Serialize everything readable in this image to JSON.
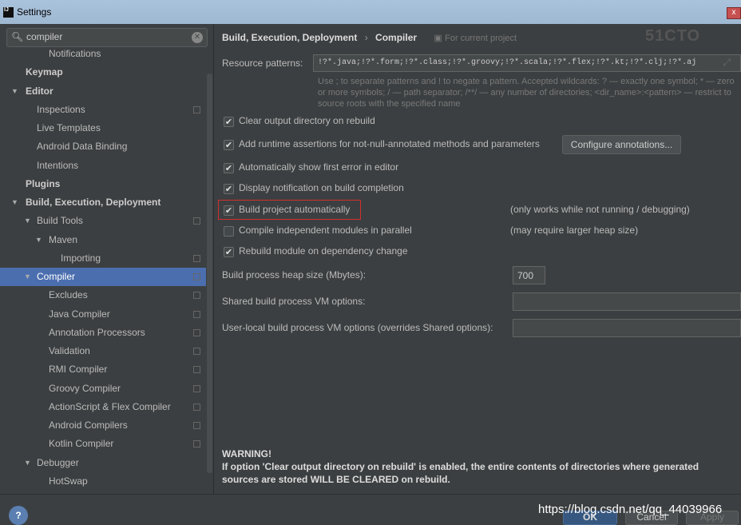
{
  "window": {
    "title": "Settings",
    "logo": "IJ",
    "close": "x"
  },
  "search": {
    "value": "compiler"
  },
  "tree": [
    {
      "label": "Notifications",
      "level": 3,
      "bold": false,
      "arrow": false,
      "copy": false
    },
    {
      "label": "Keymap",
      "level": 1,
      "bold": true,
      "arrow": false,
      "copy": false
    },
    {
      "label": "Editor",
      "level": 1,
      "bold": true,
      "arrow": true,
      "copy": false
    },
    {
      "label": "Inspections",
      "level": 2,
      "bold": false,
      "arrow": false,
      "copy": true
    },
    {
      "label": "Live Templates",
      "level": 2,
      "bold": false,
      "arrow": false,
      "copy": false
    },
    {
      "label": "Android Data Binding",
      "level": 2,
      "bold": false,
      "arrow": false,
      "copy": false
    },
    {
      "label": "Intentions",
      "level": 2,
      "bold": false,
      "arrow": false,
      "copy": false
    },
    {
      "label": "Plugins",
      "level": 1,
      "bold": true,
      "arrow": false,
      "copy": false
    },
    {
      "label": "Build, Execution, Deployment",
      "level": 1,
      "bold": true,
      "arrow": true,
      "copy": false
    },
    {
      "label": "Build Tools",
      "level": 2,
      "bold": false,
      "arrow": true,
      "copy": true
    },
    {
      "label": "Maven",
      "level": 3,
      "bold": false,
      "arrow": true,
      "copy": false
    },
    {
      "label": "Importing",
      "level": 4,
      "bold": false,
      "arrow": false,
      "copy": true
    },
    {
      "label": "Compiler",
      "level": 2,
      "bold": false,
      "arrow": true,
      "copy": true,
      "selected": true
    },
    {
      "label": "Excludes",
      "level": 3,
      "bold": false,
      "arrow": false,
      "copy": true
    },
    {
      "label": "Java Compiler",
      "level": 3,
      "bold": false,
      "arrow": false,
      "copy": true
    },
    {
      "label": "Annotation Processors",
      "level": 3,
      "bold": false,
      "arrow": false,
      "copy": true
    },
    {
      "label": "Validation",
      "level": 3,
      "bold": false,
      "arrow": false,
      "copy": true
    },
    {
      "label": "RMI Compiler",
      "level": 3,
      "bold": false,
      "arrow": false,
      "copy": true
    },
    {
      "label": "Groovy Compiler",
      "level": 3,
      "bold": false,
      "arrow": false,
      "copy": true
    },
    {
      "label": "ActionScript & Flex Compiler",
      "level": 3,
      "bold": false,
      "arrow": false,
      "copy": true
    },
    {
      "label": "Android Compilers",
      "level": 3,
      "bold": false,
      "arrow": false,
      "copy": true
    },
    {
      "label": "Kotlin Compiler",
      "level": 3,
      "bold": false,
      "arrow": false,
      "copy": true
    },
    {
      "label": "Debugger",
      "level": 2,
      "bold": false,
      "arrow": true,
      "copy": false
    },
    {
      "label": "HotSwap",
      "level": 3,
      "bold": false,
      "arrow": false,
      "copy": false
    }
  ],
  "breadcrumb": {
    "parent": "Build, Execution, Deployment",
    "sep": "›",
    "current": "Compiler",
    "scope": "For current project"
  },
  "resource": {
    "label": "Resource patterns:",
    "value": "!?*.java;!?*.form;!?*.class;!?*.groovy;!?*.scala;!?*.flex;!?*.kt;!?*.clj;!?*.aj",
    "hint": "Use ; to separate patterns and ! to negate a pattern. Accepted wildcards: ? — exactly one symbol; * — zero or more symbols; / — path separator; /**/ — any number of directories; <dir_name>:<pattern> — restrict to source roots with the specified name"
  },
  "options": [
    {
      "label": "Clear output directory on rebuild",
      "checked": true,
      "note": ""
    },
    {
      "label": "Add runtime assertions for not-null-annotated methods and parameters",
      "checked": true,
      "note": ""
    },
    {
      "label": "Automatically show first error in editor",
      "checked": true,
      "note": ""
    },
    {
      "label": "Display notification on build completion",
      "checked": true,
      "note": ""
    },
    {
      "label": "Build project automatically",
      "checked": true,
      "note": "(only works while not running / debugging)",
      "highlighted": true
    },
    {
      "label": "Compile independent modules in parallel",
      "checked": false,
      "note": "(may require larger heap size)"
    },
    {
      "label": "Rebuild module on dependency change",
      "checked": true,
      "note": ""
    }
  ],
  "configure_button": "Configure annotations...",
  "heap": {
    "label": "Build process heap size (Mbytes):",
    "value": "700"
  },
  "shared_vm": {
    "label": "Shared build process VM options:",
    "value": ""
  },
  "local_vm": {
    "label": "User-local build process VM options (overrides Shared options):",
    "value": ""
  },
  "warning": {
    "title": "WARNING!",
    "text": "If option 'Clear output directory on rebuild' is enabled, the entire contents of directories where generated sources are stored WILL BE CLEARED on rebuild."
  },
  "buttons": {
    "help": "?",
    "ok": "OK",
    "cancel": "Cancel",
    "apply": "Apply"
  },
  "watermark": "https://blog.csdn.net/qq_44039966",
  "logo_watermark": "51CTO学院",
  "colors": {
    "selection": "#4b6eaf",
    "highlight": "#d03030",
    "background": "#3c3f41"
  }
}
